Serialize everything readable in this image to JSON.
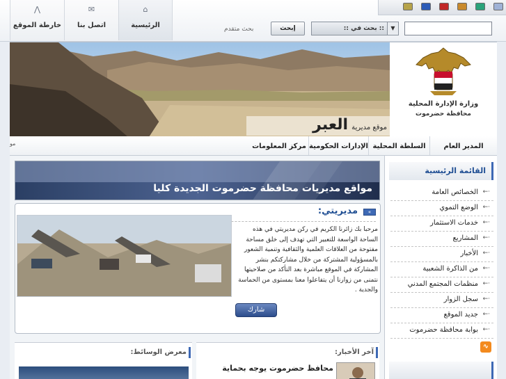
{
  "topnav": {
    "sitemap": "خارطة الموقع",
    "contact": "اتصل بنا",
    "home": "الرئيسية"
  },
  "theme_swatches": [
    "#9fb2d6",
    "#2aa37a",
    "#c98a2c",
    "#c12727",
    "#2b5bb7",
    "#b6a34a"
  ],
  "search": {
    "button": "إبحث",
    "scope": ":: بحث في ::",
    "advanced": "بحث متقدم",
    "placeholder": ""
  },
  "banner": {
    "caption_small": "موقع مديرية",
    "caption_big": "العبر",
    "logo_line1": "وزارة الإدارة المحلية",
    "logo_line2": "محافظة حضرموت"
  },
  "menu": [
    "المدير العام",
    "السلطة المحلية",
    "الإدارات الحكومية",
    "مركز المعلومات"
  ],
  "menu_cut": "مو",
  "promo": {
    "text": "مواقع مديريات محافظة حضرموت الجديدة كليا"
  },
  "my_directorate": {
    "title": "مديريتي:",
    "body": "مرحبا بك زائرنا الكريم في ركن مديريتي في هذه الساحة الواسعة للتعبير التي تهدف إلى خلق مساحة مفتوحة من العلاقات العلمية والثقافية وتنمية الشعور بالمسؤولية المشتركة من خلال مشاركتكم بنشر المشاركة في الموقع مباشرة بعد التأكد من صلاحيتها نتمنى من زوارنا أن يتفاعلوا معنا بمستوى من الحماسة والجدية .",
    "join_button": "شارك"
  },
  "news": {
    "title": "آخر الأخبار:",
    "headline": "محافظ حضرموت يوجه بحماية"
  },
  "media": {
    "title": "معرض الوسائط:"
  },
  "sidebar": {
    "title": "القائمة الرئيسية",
    "items": [
      "الخصائص العامة",
      "الوضع التموي",
      "خدمات الاستثمار",
      "المشاريع",
      "الأخبار",
      "من الذاكرة الشعبية",
      "منظمات المجتمع المدني",
      "سجل الزوار",
      "جديد الموقع",
      "بوابة محافظة حضرموت"
    ],
    "rss": "RSS"
  }
}
